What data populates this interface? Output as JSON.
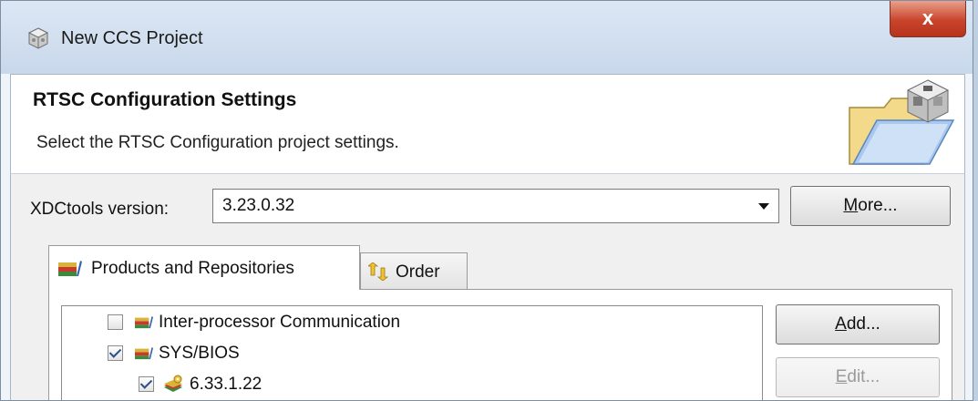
{
  "window": {
    "title": "New CCS Project",
    "close_glyph": "x",
    "app_icon": "gear-cube-icon"
  },
  "header": {
    "title": "RTSC Configuration Settings",
    "subtitle": "Select the RTSC Configuration project settings.",
    "banner_icon": "folder-cube-icon"
  },
  "xdc": {
    "label": "XDCtools version:",
    "selected_value": "3.23.0.32",
    "more_button": {
      "pre": "",
      "mnemonic": "M",
      "post": "ore..."
    }
  },
  "tabs": [
    {
      "label": "Products and Repositories",
      "icon": "books-icon",
      "active": true
    },
    {
      "label": "Order",
      "icon": "order-arrows-icon",
      "active": false
    }
  ],
  "tree": {
    "items": [
      {
        "label": "Inter-processor Communication",
        "checked": false,
        "icon": "books-icon",
        "level": 0
      },
      {
        "label": "SYS/BIOS",
        "checked": true,
        "icon": "books-icon",
        "level": 0
      },
      {
        "label": "6.33.1.22",
        "checked": true,
        "icon": "package-gear-icon",
        "level": 1
      }
    ]
  },
  "side_buttons": {
    "add": {
      "mnemonic": "A",
      "post": "dd...",
      "enabled": true
    },
    "edit": {
      "mnemonic": "E",
      "post": "dit...",
      "enabled": false
    }
  },
  "colors": {
    "close_red": "#c9442b",
    "window_frame": "#bfcfe2",
    "checkmark": "#2a4f8a"
  }
}
